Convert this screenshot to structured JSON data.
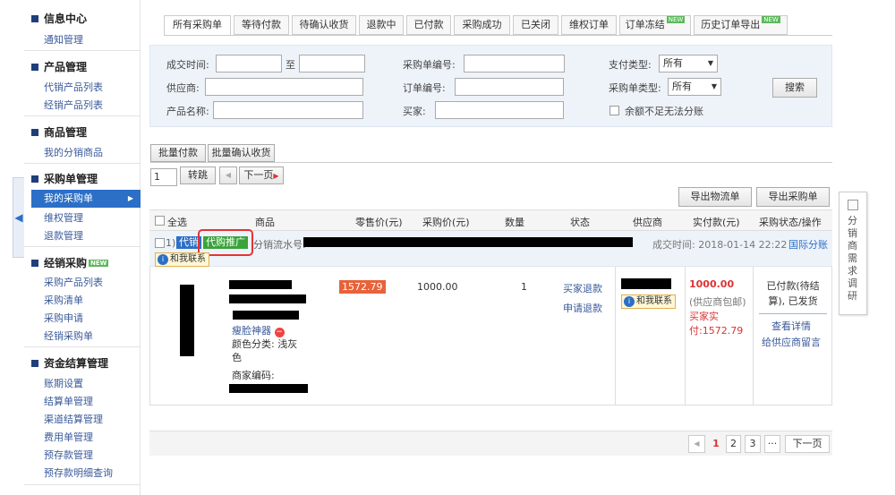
{
  "sidebar": {
    "sections": [
      {
        "title": "信息中心",
        "items": [
          "通知管理"
        ]
      },
      {
        "title": "产品管理",
        "items": [
          "代销产品列表",
          "经销产品列表"
        ]
      },
      {
        "title": "商品管理",
        "items": [
          "我的分销商品"
        ]
      },
      {
        "title": "采购单管理",
        "items": [
          "我的采购单",
          "维权管理",
          "退款管理"
        ]
      },
      {
        "title": "经销采购",
        "badge": "NEW",
        "items": [
          "采购产品列表",
          "采购清单",
          "采购申请",
          "经销采购单"
        ]
      },
      {
        "title": "资金结算管理",
        "items": [
          "账期设置",
          "结算单管理",
          "渠道结算管理",
          "费用单管理",
          "预存款管理",
          "预存款明细查询"
        ]
      }
    ],
    "active_item": "我的采购单"
  },
  "tabs": [
    "所有采购单",
    "等待付款",
    "待确认收货",
    "退款中",
    "已付款",
    "采购成功",
    "已关闭",
    "维权订单",
    "订单冻结",
    "历史订单导出"
  ],
  "tab_badge": "NEW",
  "search": {
    "deal_time_label": "成交时间:",
    "to_label": "至",
    "supplier_label": "供应商:",
    "product_name_label": "产品名称:",
    "po_number_label": "采购单编号:",
    "order_number_label": "订单编号:",
    "buyer_label": "买家:",
    "pay_type_label": "支付类型:",
    "pay_type_value": "所有",
    "po_type_label": "采购单类型:",
    "po_type_value": "所有",
    "insufficient_label": "余额不足无法分账",
    "search_button": "搜索"
  },
  "batch": {
    "pay": "批量付款",
    "confirm": "批量确认收货"
  },
  "pager_top": {
    "page_value": "1",
    "jump": "转跳",
    "prev": "◀",
    "next": "下一页"
  },
  "export": {
    "logistics": "导出物流单",
    "po": "导出采购单"
  },
  "table_headers": [
    "全选",
    "商品",
    "零售价(元)",
    "采购价(元)",
    "数量",
    "状态",
    "供应商",
    "实付款(元)",
    "采购状态/操作"
  ],
  "order": {
    "index": "1)",
    "tag_consign": "代销",
    "tag_promo": "代购推广",
    "flow_label": "分销流水号:",
    "deal_time": "成交时间: 2018-01-14 22:22",
    "channel": "国际分账",
    "contact_btn": "和我联系",
    "product_name": "瘦脸神器",
    "color_label": "颜色分类: 浅灰色",
    "merchant_code": "商家编码:",
    "retail_price": "1572.79",
    "purchase_price": "1000.00",
    "quantity": "1",
    "status_buyer_refund": "买家退款",
    "status_apply_refund": "申请退款",
    "supplier_contact": "和我联系",
    "paid_amount": "1000.00",
    "paid_note": "(供应商包邮)",
    "buyer_paid": "买家实付:1572.79",
    "po_status": "已付款(待结算), 已发货",
    "view_detail": "查看详情",
    "message_supplier": "给供应商留言"
  },
  "pager_bottom": {
    "prev": "◀",
    "pages": [
      "1",
      "2",
      "3"
    ],
    "ellipsis": "···",
    "next": "下一页",
    "current": "1"
  },
  "float_panel": {
    "text": "分销商需求调研"
  },
  "colors": {
    "accent": "#2b6fc7",
    "highlight": "#e53333",
    "price_tag": "#e8623a",
    "tag_green": "#3aa33a"
  }
}
